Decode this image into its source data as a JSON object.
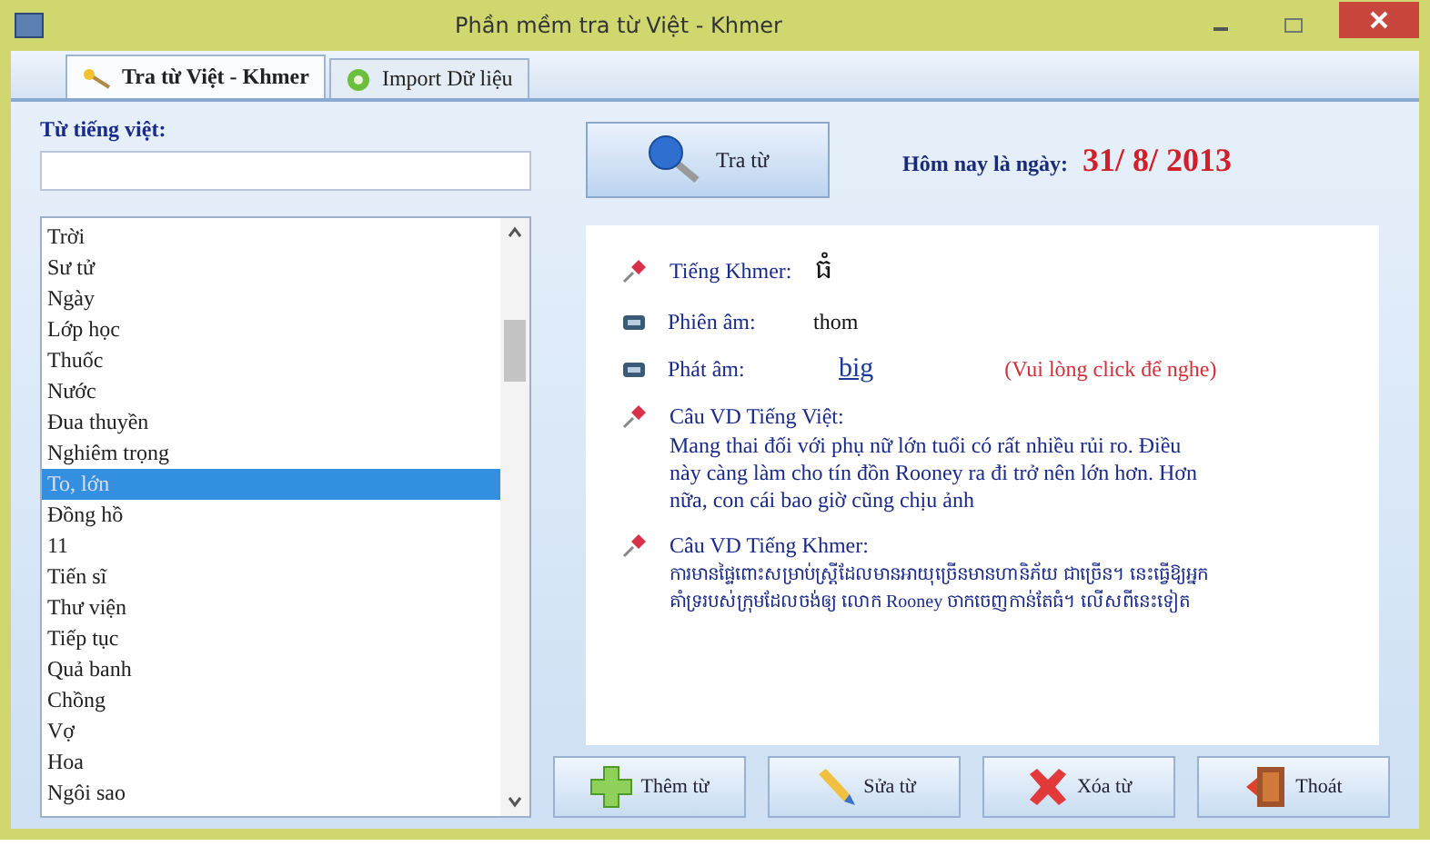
{
  "window": {
    "title": "Phần mềm tra từ Việt - Khmer"
  },
  "tabs": [
    {
      "label": "Tra từ Việt - Khmer",
      "selected": true
    },
    {
      "label": "Import Dữ liệu",
      "selected": false
    }
  ],
  "search": {
    "label": "Từ tiếng việt:"
  },
  "words": [
    {
      "text": "Trời",
      "selected": false
    },
    {
      "text": "Sư tử",
      "selected": false
    },
    {
      "text": "Ngày",
      "selected": false
    },
    {
      "text": "Lớp học",
      "selected": false
    },
    {
      "text": "Thuốc",
      "selected": false
    },
    {
      "text": "Nước",
      "selected": false
    },
    {
      "text": "Đua thuyền",
      "selected": false
    },
    {
      "text": "Nghiêm trọng",
      "selected": false
    },
    {
      "text": "To, lớn",
      "selected": true
    },
    {
      "text": "Đồng hồ",
      "selected": false
    },
    {
      "text": "11",
      "selected": false
    },
    {
      "text": "Tiến sĩ",
      "selected": false
    },
    {
      "text": "Thư viện",
      "selected": false
    },
    {
      "text": "Tiếp tục",
      "selected": false
    },
    {
      "text": "Quả banh",
      "selected": false
    },
    {
      "text": "Chồng",
      "selected": false
    },
    {
      "text": "Vợ",
      "selected": false
    },
    {
      "text": "Hoa",
      "selected": false
    },
    {
      "text": "Ngôi sao",
      "selected": false
    }
  ],
  "search_button": {
    "label": "Tra từ"
  },
  "today": {
    "label": "Hôm nay là ngày:",
    "date": "31/ 8/ 2013"
  },
  "details": [
    {
      "kind": "khmer",
      "label": "Tiếng Khmer:",
      "value": "ធំ"
    },
    {
      "kind": "transcription",
      "label": "Phiên âm:",
      "value": "thom"
    },
    {
      "kind": "audio",
      "label": "Phát âm:",
      "value": "big",
      "note": "(Vui lòng click để nghe)"
    },
    {
      "kind": "example",
      "label": "Câu VD Tiếng Việt:",
      "value": "Mang thai đối với phụ nữ lớn tuổi có rất nhiều rủi ro. Điều này càng làm cho tín đồn Rooney ra đi trở nên lớn hơn. Hơn nữa, con cái bao giờ cũng chịu ảnh"
    },
    {
      "kind": "example",
      "label": "Câu VD Tiếng Khmer:",
      "value": "ការមានផ្ទៃពោះសម្រាប់ស្ត្រីដែលមានអាយុច្រើនមានហានិភ័យ ជាច្រើន។ នេះធ្វើឱ្យអ្នកគាំទ្ររបស់ក្រុមដែលចង់ឲ្យ លោក Rooney ចាកចេញកាន់តែធំ។ លើសពីនេះទៀត"
    }
  ],
  "buttons": [
    {
      "label": "Thêm từ"
    },
    {
      "label": "Sửa từ"
    },
    {
      "label": "Xóa từ"
    },
    {
      "label": "Thoát"
    }
  ]
}
